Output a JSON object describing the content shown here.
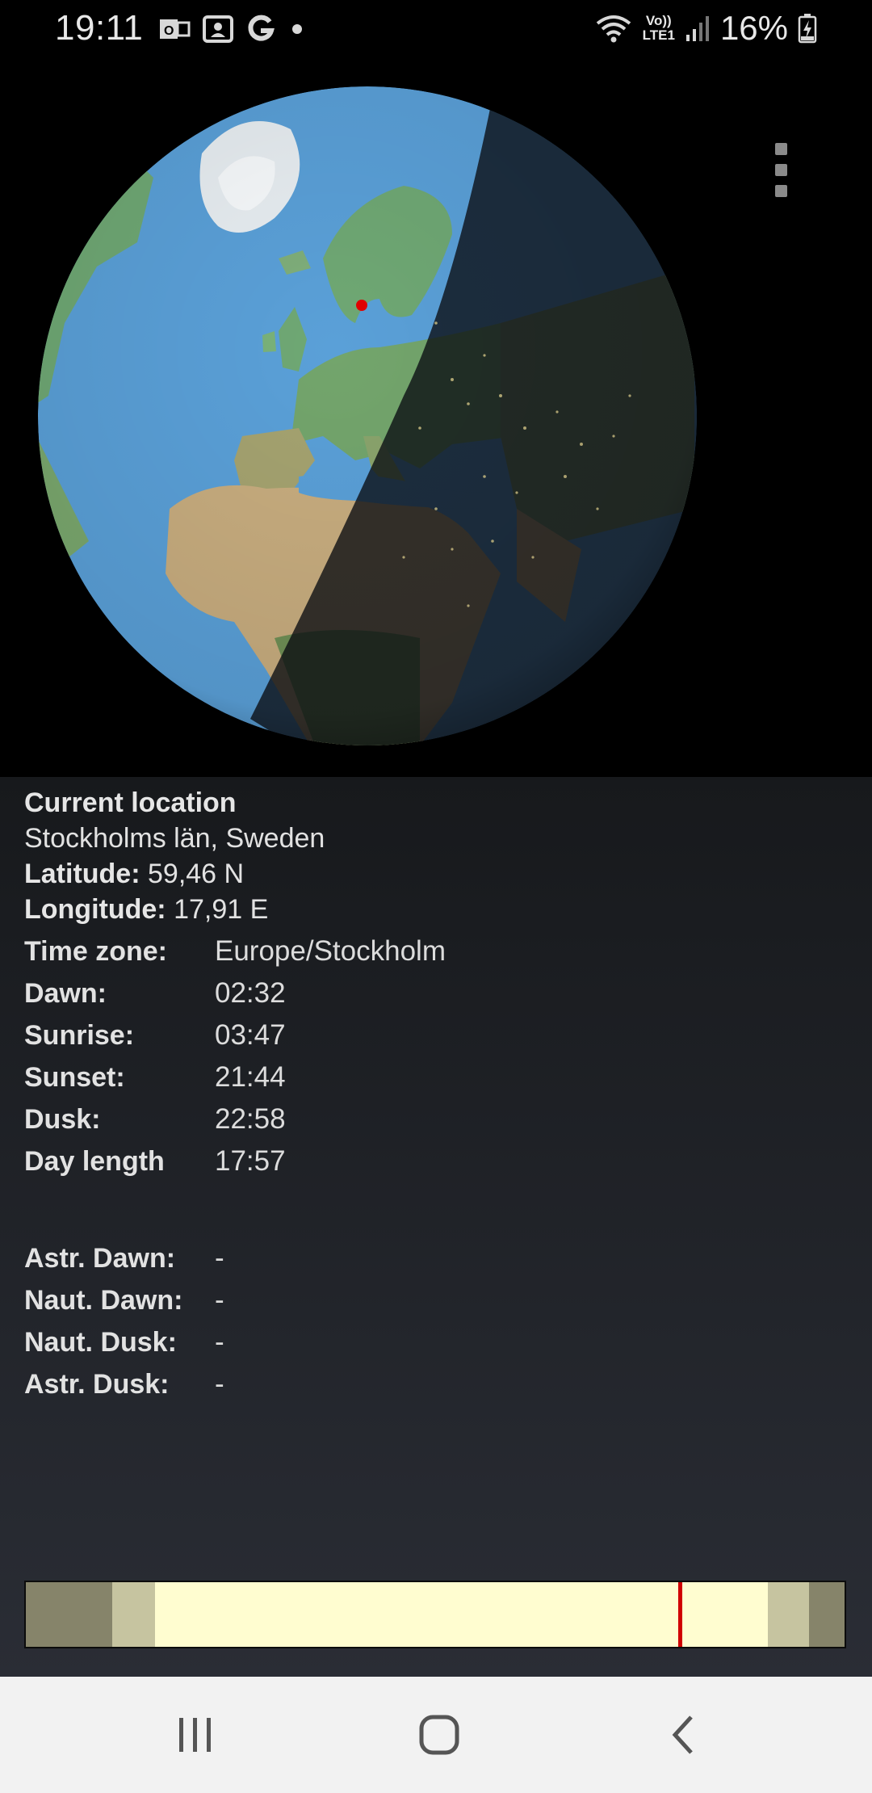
{
  "status_bar": {
    "time": "19:11",
    "battery": "16%",
    "notification_icons": [
      "outlook-icon",
      "screen-record-icon",
      "google-icon",
      "dot-icon"
    ],
    "network_label_top": "Vo))",
    "network_label_bottom": "LTE1"
  },
  "location": {
    "heading": "Current location",
    "place": "Stockholms län, Sweden",
    "latitude_label": "Latitude:",
    "latitude_value": "59,46 N",
    "longitude_label": "Longitude:",
    "longitude_value": "17,91 E"
  },
  "times": [
    {
      "label": "Time zone:",
      "value": "Europe/Stockholm"
    },
    {
      "label": "Dawn:",
      "value": "02:32"
    },
    {
      "label": "Sunrise:",
      "value": "03:47"
    },
    {
      "label": "Sunset:",
      "value": "21:44"
    },
    {
      "label": "Dusk:",
      "value": "22:58"
    },
    {
      "label": "Day length",
      "value": "17:57"
    }
  ],
  "twilight": [
    {
      "label": "Astr. Dawn:",
      "value": "-"
    },
    {
      "label": "Naut. Dawn:",
      "value": "-"
    },
    {
      "label": "Naut. Dusk:",
      "value": "-"
    },
    {
      "label": "Astr. Dusk:",
      "value": "-"
    }
  ],
  "day_bar": {
    "dawn_fraction": 0.106,
    "sunrise_fraction": 0.158,
    "sunset_fraction": 0.906,
    "dusk_fraction": 0.957,
    "now_fraction": 0.799,
    "colors": {
      "night": "#86846a",
      "twilight": "#c6c4a0",
      "day": "#fffdd0",
      "now": "#d00000"
    }
  },
  "colors": {
    "ocean": "#5aa0d8",
    "land": "#6fa874",
    "desert": "#c8ad7f",
    "marker": "#e00000"
  }
}
